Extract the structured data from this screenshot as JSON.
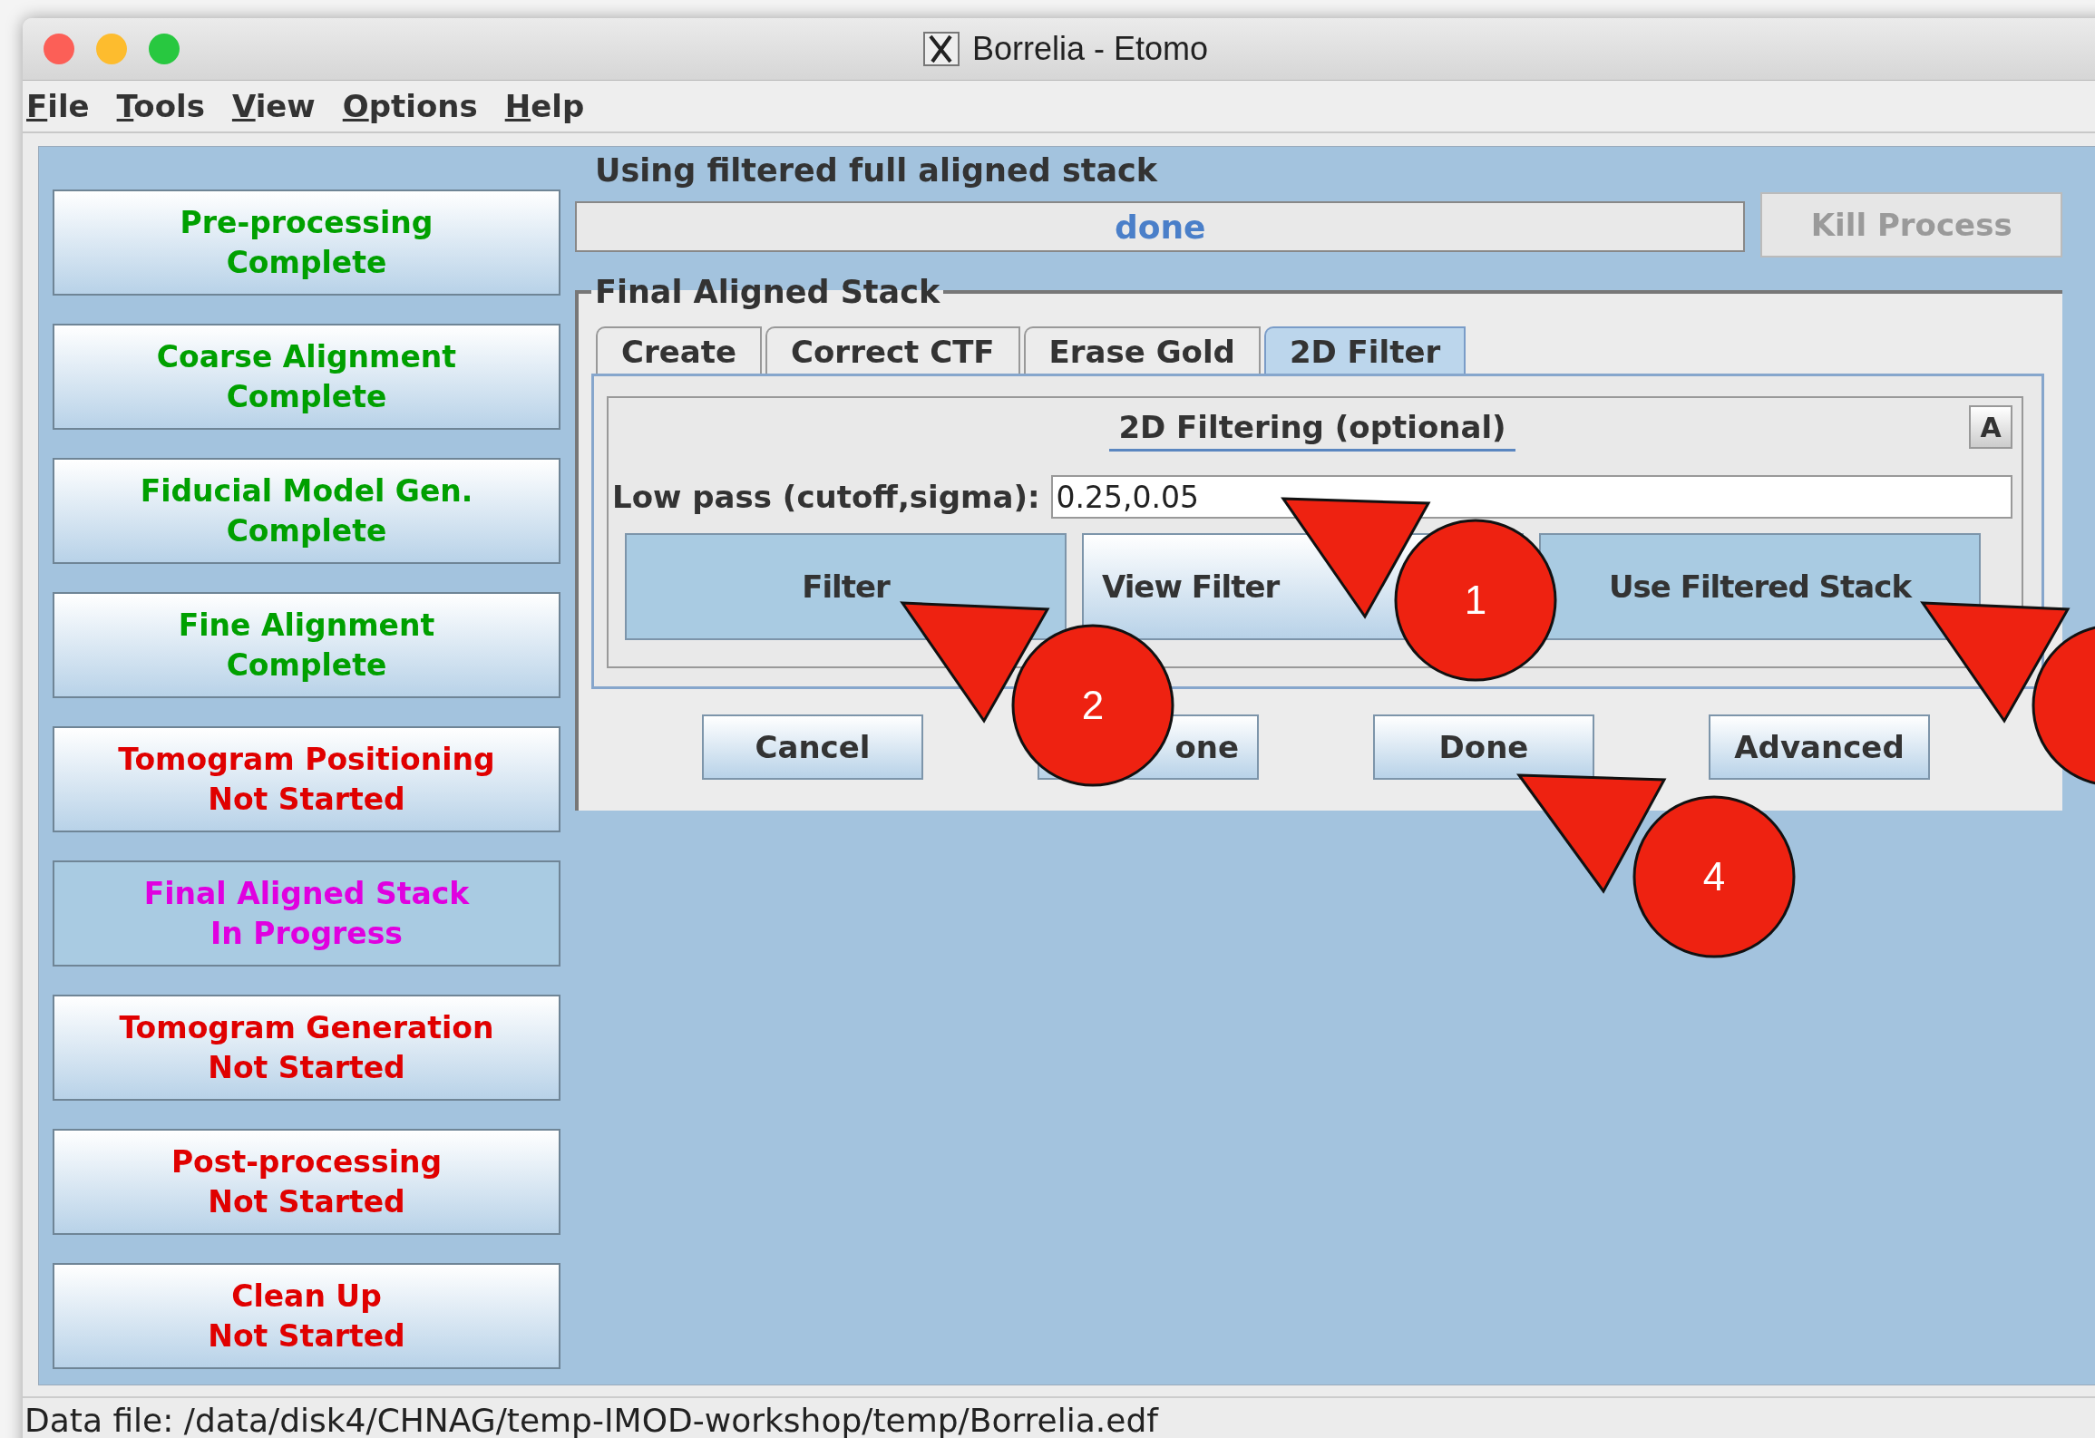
{
  "window": {
    "title": "Borrelia - Etomo"
  },
  "menu": [
    {
      "label": "File"
    },
    {
      "label": "Tools"
    },
    {
      "label": "View"
    },
    {
      "label": "Options"
    },
    {
      "label": "Help"
    }
  ],
  "sidebar": [
    {
      "title": "Pre-processing",
      "status": "Complete",
      "kind": "complete"
    },
    {
      "title": "Coarse Alignment",
      "status": "Complete",
      "kind": "complete"
    },
    {
      "title": "Fiducial Model Gen.",
      "status": "Complete",
      "kind": "complete"
    },
    {
      "title": "Fine Alignment",
      "status": "Complete",
      "kind": "complete"
    },
    {
      "title": "Tomogram Positioning",
      "status": "Not Started",
      "kind": "not_started"
    },
    {
      "title": "Final Aligned Stack",
      "status": "In Progress",
      "kind": "in_progress"
    },
    {
      "title": "Tomogram Generation",
      "status": "Not Started",
      "kind": "not_started"
    },
    {
      "title": "Post-processing",
      "status": "Not Started",
      "kind": "not_started"
    },
    {
      "title": "Clean Up",
      "status": "Not Started",
      "kind": "not_started"
    }
  ],
  "heading": "Using filtered full aligned stack",
  "progress": {
    "text": "done"
  },
  "kill_button": {
    "label": "Kill Process",
    "disabled": true
  },
  "group": {
    "title": "Final Aligned Stack",
    "tabs": [
      {
        "label": "Create",
        "selected": false
      },
      {
        "label": "Correct CTF",
        "selected": false
      },
      {
        "label": "Erase Gold",
        "selected": false
      },
      {
        "label": "2D Filter",
        "selected": true
      }
    ],
    "section_title": "2D Filtering (optional)",
    "advanced_toggle": "A",
    "field": {
      "label": "Low pass (cutoff,sigma):",
      "value": "0.25,0.05"
    },
    "actions": [
      {
        "label": "Filter",
        "pressed": true
      },
      {
        "label": "View Filter",
        "pressed": false
      },
      {
        "label": "Use Filtered Stack",
        "pressed": true
      }
    ],
    "buttons": [
      {
        "label": "Cancel"
      },
      {
        "label": "one"
      },
      {
        "label": "Done"
      },
      {
        "label": "Advanced"
      }
    ]
  },
  "callouts": [
    {
      "kind": "numbered",
      "number": "1"
    },
    {
      "kind": "numbered",
      "number": "2"
    },
    {
      "kind": "plain"
    },
    {
      "kind": "numbered",
      "number": "4"
    }
  ],
  "status_bar": "Data file: /data/disk4/CHNAG/temp-IMOD-workshop/temp/Borrelia.edf"
}
